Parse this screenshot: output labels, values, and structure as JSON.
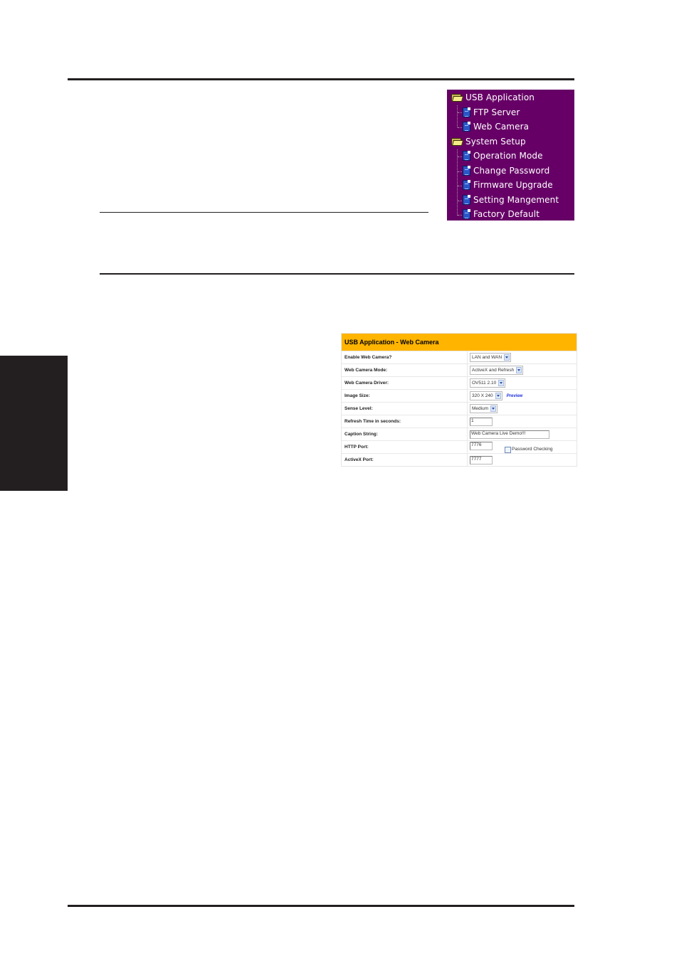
{
  "tree_menu": {
    "background": "#660066",
    "groups": [
      {
        "label": "USB Application",
        "icon": "folder-icon",
        "items": [
          {
            "label": "FTP Server",
            "icon": "page-icon"
          },
          {
            "label": "Web Camera",
            "icon": "page-icon"
          }
        ]
      },
      {
        "label": "System Setup",
        "icon": "folder-icon",
        "items": [
          {
            "label": "Operation Mode",
            "icon": "page-icon"
          },
          {
            "label": "Change Password",
            "icon": "page-icon"
          },
          {
            "label": "Firmware Upgrade",
            "icon": "page-icon"
          },
          {
            "label": "Setting Mangement",
            "icon": "page-icon"
          },
          {
            "label": "Factory Default",
            "icon": "page-icon"
          }
        ]
      }
    ]
  },
  "web_camera_panel": {
    "title": "USB Application - Web Camera",
    "header_color": "#ffb400",
    "rows": [
      {
        "label": "Enable Web Camera?",
        "type": "select",
        "value": "LAN and WAN"
      },
      {
        "label": "Web Camera Mode:",
        "type": "select",
        "value": "ActiveX and Refresh"
      },
      {
        "label": "Web Camera Driver:",
        "type": "select",
        "value": "OV511 2.10"
      },
      {
        "label": "Image Size:",
        "type": "select",
        "value": "320 X 240",
        "link": "Preview"
      },
      {
        "label": "Sense Level:",
        "type": "select",
        "value": "Medium"
      },
      {
        "label": "Refresh Time in seconds:",
        "type": "text",
        "value": "1"
      },
      {
        "label": "Caption String:",
        "type": "text",
        "value": "Web Camera Live Demo!!!"
      },
      {
        "label": "HTTP Port:",
        "type": "text",
        "value": "7776",
        "checkbox": {
          "label": "Password Checking",
          "checked": false
        }
      },
      {
        "label": "ActiveX Port:",
        "type": "text",
        "value": "7777"
      }
    ]
  }
}
